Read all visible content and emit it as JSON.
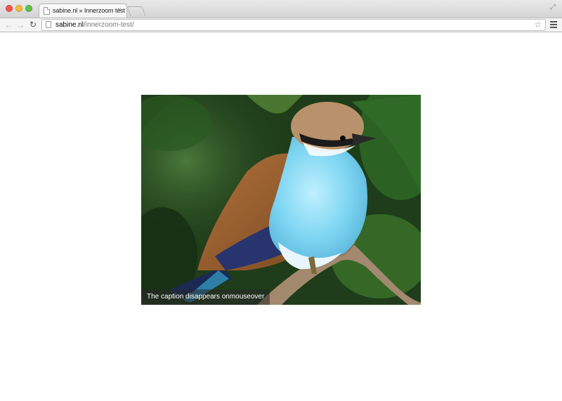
{
  "browser": {
    "tab": {
      "title": "sabine.nl » Innerzoom test",
      "close_label": "×"
    },
    "address": {
      "host": "sabine.nl",
      "path": "/innerzoom-test/"
    },
    "icons": {
      "back": "arrow-left-icon",
      "forward": "arrow-right-icon",
      "reload": "reload-icon",
      "bookmark": "star-icon",
      "menu": "hamburger-menu-icon",
      "fullscreen": "fullscreen-icon"
    },
    "colors": {
      "close": "#f2564e",
      "minimize": "#f5bb35",
      "zoom": "#5bc545"
    }
  },
  "page": {
    "image": {
      "subject": "bird-photo",
      "caption": "The caption disappears onmouseover"
    }
  }
}
